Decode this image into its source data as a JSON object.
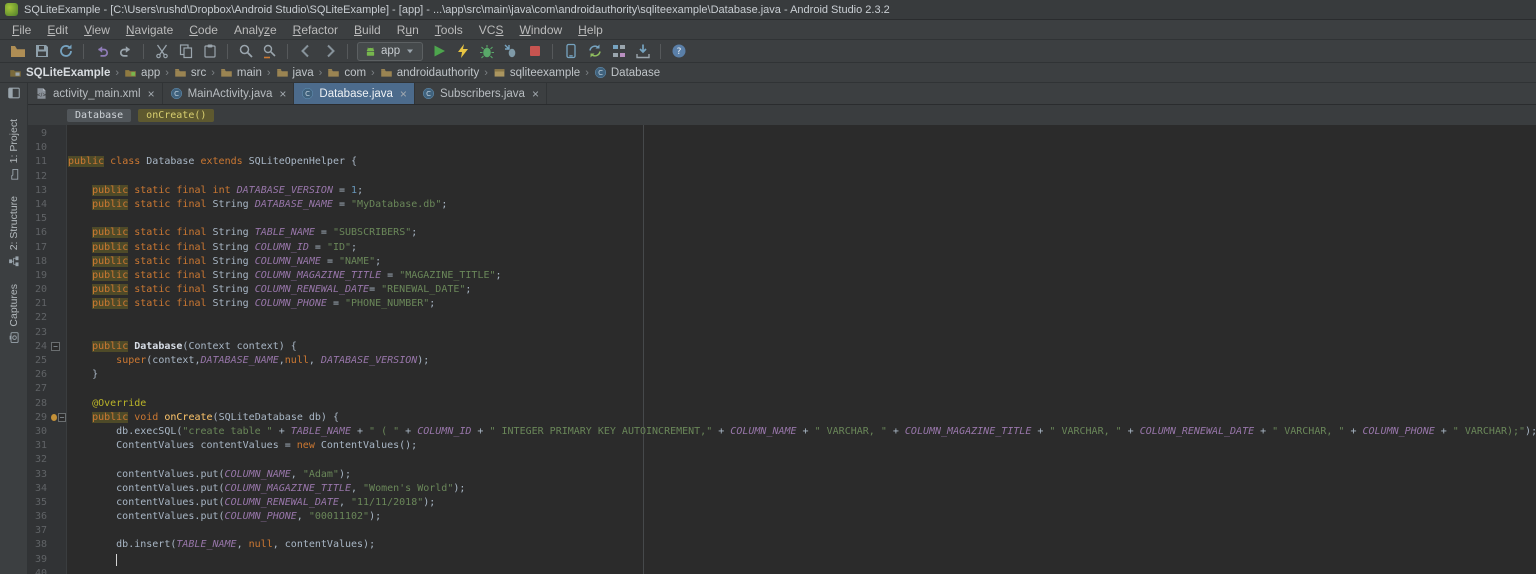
{
  "title_bar": {
    "title": "SQLiteExample - [C:\\Users\\rushd\\Dropbox\\Android Studio\\SQLiteExample] - [app] - ...\\app\\src\\main\\java\\com\\androidauthority\\sqliteexample\\Database.java - Android Studio 2.3.2"
  },
  "theme": {
    "editor_bg": "#2b2b2b",
    "gutter_bg": "#313335",
    "chrome_bg": "#3c3f41",
    "keyword": "#cc7832",
    "string": "#6a8759",
    "constant": "#9876aa",
    "number": "#6897bb",
    "annotation": "#bbb529",
    "method": "#ffc66b",
    "active_tab": "#4c6b8c",
    "occurrence_highlight": "#4e4a28",
    "run_green": "#4da54d",
    "stop_red": "#c75450"
  },
  "menu": {
    "items": [
      {
        "label": "File",
        "m": 0
      },
      {
        "label": "Edit",
        "m": 0
      },
      {
        "label": "View",
        "m": 0
      },
      {
        "label": "Navigate",
        "m": 0
      },
      {
        "label": "Code",
        "m": 0
      },
      {
        "label": "Analyze",
        "m": 5
      },
      {
        "label": "Refactor",
        "m": 0
      },
      {
        "label": "Build",
        "m": 0
      },
      {
        "label": "Run",
        "m": 1
      },
      {
        "label": "Tools",
        "m": 0
      },
      {
        "label": "VCS",
        "m": 2
      },
      {
        "label": "Window",
        "m": 0
      },
      {
        "label": "Help",
        "m": 0
      }
    ]
  },
  "toolbar": {
    "run_config_label": "app",
    "items": [
      {
        "icon": "open",
        "name": "open-file-button"
      },
      {
        "icon": "save",
        "name": "save-all-button"
      },
      {
        "icon": "sync",
        "name": "synchronize-button"
      },
      {
        "sep": true
      },
      {
        "icon": "undo",
        "name": "undo-button"
      },
      {
        "icon": "redo",
        "name": "redo-button"
      },
      {
        "sep": true
      },
      {
        "icon": "cut",
        "name": "cut-button"
      },
      {
        "icon": "copy",
        "name": "copy-button"
      },
      {
        "icon": "paste",
        "name": "paste-button"
      },
      {
        "sep": true
      },
      {
        "icon": "find",
        "name": "find-button"
      },
      {
        "icon": "replace",
        "name": "replace-button"
      },
      {
        "sep": true
      },
      {
        "icon": "back",
        "name": "back-button"
      },
      {
        "icon": "forward",
        "name": "forward-button"
      },
      {
        "sep": true
      },
      {
        "runconfig": true
      },
      {
        "icon": "run",
        "name": "run-button"
      },
      {
        "icon": "apply",
        "name": "instant-run-button"
      },
      {
        "icon": "debug",
        "name": "debug-button"
      },
      {
        "icon": "attach",
        "name": "attach-debugger-button"
      },
      {
        "icon": "stop",
        "name": "stop-button"
      },
      {
        "sep": true
      },
      {
        "icon": "avd",
        "name": "avd-manager-button"
      },
      {
        "icon": "gradle",
        "name": "gradle-sync-button"
      },
      {
        "icon": "structure",
        "name": "project-structure-button"
      },
      {
        "icon": "sdk",
        "name": "sdk-manager-button"
      },
      {
        "sep": true
      },
      {
        "icon": "help",
        "name": "help-button"
      }
    ]
  },
  "navbar": {
    "separator": "›",
    "items": [
      {
        "label": "SQLiteExample",
        "icon": "project",
        "bold": true
      },
      {
        "label": "app",
        "icon": "module"
      },
      {
        "label": "src",
        "icon": "folder"
      },
      {
        "label": "main",
        "icon": "folder"
      },
      {
        "label": "java",
        "icon": "folder"
      },
      {
        "label": "com",
        "icon": "folder"
      },
      {
        "label": "androidauthority",
        "icon": "folder"
      },
      {
        "label": "sqliteexample",
        "icon": "package"
      },
      {
        "label": "Database",
        "icon": "class"
      }
    ]
  },
  "tool_windows": {
    "toggle_icon": "panel",
    "left": [
      {
        "label": "1: Project",
        "icon": "projectstub"
      },
      {
        "label": "2: Structure",
        "icon": "structurestub"
      },
      {
        "label": "Captures",
        "icon": "capturesstub"
      }
    ]
  },
  "tabs": {
    "close_glyph": "×",
    "items": [
      {
        "label": "activity_main.xml",
        "icon": "xmlfile",
        "active": false
      },
      {
        "label": "MainActivity.java",
        "icon": "class",
        "active": false
      },
      {
        "label": "Database.java",
        "icon": "class",
        "active": true
      },
      {
        "label": "Subscribers.java",
        "icon": "class",
        "active": false
      }
    ]
  },
  "breadcrumbs": {
    "items": [
      {
        "label": "Database",
        "state": "plain"
      },
      {
        "label": "onCreate()",
        "state": "active"
      }
    ]
  },
  "editor": {
    "first_line": 9,
    "caret": {
      "line": 39,
      "col": 8
    },
    "lines": [
      {
        "n": 9,
        "t": []
      },
      {
        "n": 10,
        "t": []
      },
      {
        "n": 11,
        "t": [
          [
            "kh",
            "public"
          ],
          [
            "p",
            " "
          ],
          [
            "k",
            "class"
          ],
          [
            "p",
            " Database "
          ],
          [
            "k",
            "extends"
          ],
          [
            "p",
            " SQLiteOpenHelper {"
          ]
        ]
      },
      {
        "n": 12,
        "t": []
      },
      {
        "n": 13,
        "t": [
          [
            "p",
            "    "
          ],
          [
            "kh",
            "public"
          ],
          [
            "p",
            " "
          ],
          [
            "k",
            "static"
          ],
          [
            "p",
            " "
          ],
          [
            "k",
            "final"
          ],
          [
            "p",
            " "
          ],
          [
            "k",
            "int"
          ],
          [
            "p",
            " "
          ],
          [
            "c",
            "DATABASE_VERSION"
          ],
          [
            "p",
            " = "
          ],
          [
            "n",
            "1"
          ],
          [
            "p",
            ";"
          ]
        ]
      },
      {
        "n": 14,
        "t": [
          [
            "p",
            "    "
          ],
          [
            "kh",
            "public"
          ],
          [
            "p",
            " "
          ],
          [
            "k",
            "static"
          ],
          [
            "p",
            " "
          ],
          [
            "k",
            "final"
          ],
          [
            "p",
            " String "
          ],
          [
            "c",
            "DATABASE_NAME"
          ],
          [
            "p",
            " = "
          ],
          [
            "s",
            "\"MyDatabase.db\""
          ],
          [
            "p",
            ";"
          ]
        ]
      },
      {
        "n": 15,
        "t": []
      },
      {
        "n": 16,
        "t": [
          [
            "p",
            "    "
          ],
          [
            "kh",
            "public"
          ],
          [
            "p",
            " "
          ],
          [
            "k",
            "static"
          ],
          [
            "p",
            " "
          ],
          [
            "k",
            "final"
          ],
          [
            "p",
            " String "
          ],
          [
            "c",
            "TABLE_NAME"
          ],
          [
            "p",
            " = "
          ],
          [
            "s",
            "\"SUBSCRIBERS\""
          ],
          [
            "p",
            ";"
          ]
        ]
      },
      {
        "n": 17,
        "t": [
          [
            "p",
            "    "
          ],
          [
            "kh",
            "public"
          ],
          [
            "p",
            " "
          ],
          [
            "k",
            "static"
          ],
          [
            "p",
            " "
          ],
          [
            "k",
            "final"
          ],
          [
            "p",
            " String "
          ],
          [
            "c",
            "COLUMN_ID"
          ],
          [
            "p",
            " = "
          ],
          [
            "s",
            "\"ID\""
          ],
          [
            "p",
            ";"
          ]
        ]
      },
      {
        "n": 18,
        "t": [
          [
            "p",
            "    "
          ],
          [
            "kh",
            "public"
          ],
          [
            "p",
            " "
          ],
          [
            "k",
            "static"
          ],
          [
            "p",
            " "
          ],
          [
            "k",
            "final"
          ],
          [
            "p",
            " String "
          ],
          [
            "c",
            "COLUMN_NAME"
          ],
          [
            "p",
            " = "
          ],
          [
            "s",
            "\"NAME\""
          ],
          [
            "p",
            ";"
          ]
        ]
      },
      {
        "n": 19,
        "t": [
          [
            "p",
            "    "
          ],
          [
            "kh",
            "public"
          ],
          [
            "p",
            " "
          ],
          [
            "k",
            "static"
          ],
          [
            "p",
            " "
          ],
          [
            "k",
            "final"
          ],
          [
            "p",
            " String "
          ],
          [
            "c",
            "COLUMN_MAGAZINE_TITLE"
          ],
          [
            "p",
            " = "
          ],
          [
            "s",
            "\"MAGAZINE_TITLE\""
          ],
          [
            "p",
            ";"
          ]
        ]
      },
      {
        "n": 20,
        "t": [
          [
            "p",
            "    "
          ],
          [
            "kh",
            "public"
          ],
          [
            "p",
            " "
          ],
          [
            "k",
            "static"
          ],
          [
            "p",
            " "
          ],
          [
            "k",
            "final"
          ],
          [
            "p",
            " String "
          ],
          [
            "c",
            "COLUMN_RENEWAL_DATE"
          ],
          [
            "p",
            "= "
          ],
          [
            "s",
            "\"RENEWAL_DATE\""
          ],
          [
            "p",
            ";"
          ]
        ]
      },
      {
        "n": 21,
        "t": [
          [
            "p",
            "    "
          ],
          [
            "kh",
            "public"
          ],
          [
            "p",
            " "
          ],
          [
            "k",
            "static"
          ],
          [
            "p",
            " "
          ],
          [
            "k",
            "final"
          ],
          [
            "p",
            " String "
          ],
          [
            "c",
            "COLUMN_PHONE"
          ],
          [
            "p",
            " = "
          ],
          [
            "s",
            "\"PHONE_NUMBER\""
          ],
          [
            "p",
            ";"
          ]
        ]
      },
      {
        "n": 22,
        "t": []
      },
      {
        "n": 23,
        "t": []
      },
      {
        "n": 24,
        "fold": true,
        "t": [
          [
            "p",
            "    "
          ],
          [
            "kh",
            "public"
          ],
          [
            "p",
            " "
          ],
          [
            "w",
            "Database"
          ],
          [
            "p",
            "(Context context) {"
          ]
        ]
      },
      {
        "n": 25,
        "t": [
          [
            "p",
            "        "
          ],
          [
            "k",
            "super"
          ],
          [
            "p",
            "(context,"
          ],
          [
            "c",
            "DATABASE_NAME"
          ],
          [
            "p",
            ","
          ],
          [
            "k",
            "null"
          ],
          [
            "p",
            ", "
          ],
          [
            "c",
            "DATABASE_VERSION"
          ],
          [
            "p",
            ");"
          ]
        ]
      },
      {
        "n": 26,
        "t": [
          [
            "p",
            "    }"
          ]
        ]
      },
      {
        "n": 27,
        "t": []
      },
      {
        "n": 28,
        "t": [
          [
            "p",
            "    "
          ],
          [
            "a",
            "@Override"
          ]
        ]
      },
      {
        "n": 29,
        "fold": true,
        "gicon": "override",
        "t": [
          [
            "p",
            "    "
          ],
          [
            "kh",
            "public"
          ],
          [
            "p",
            " "
          ],
          [
            "k",
            "void"
          ],
          [
            "p",
            " "
          ],
          [
            "m",
            "onCreate"
          ],
          [
            "p",
            "(SQLiteDatabase db) {"
          ]
        ]
      },
      {
        "n": 30,
        "t": [
          [
            "p",
            "        db.execSQL("
          ],
          [
            "s",
            "\"create table \""
          ],
          [
            "p",
            " + "
          ],
          [
            "c",
            "TABLE_NAME"
          ],
          [
            "p",
            " + "
          ],
          [
            "s",
            "\" ( \""
          ],
          [
            "p",
            " + "
          ],
          [
            "c",
            "COLUMN_ID"
          ],
          [
            "p",
            " + "
          ],
          [
            "s",
            "\" INTEGER PRIMARY KEY AUTOINCREMENT,\""
          ],
          [
            "p",
            " + "
          ],
          [
            "c",
            "COLUMN_NAME"
          ],
          [
            "p",
            " + "
          ],
          [
            "s",
            "\" VARCHAR, \""
          ],
          [
            "p",
            " + "
          ],
          [
            "c",
            "COLUMN_MAGAZINE_TITLE"
          ],
          [
            "p",
            " + "
          ],
          [
            "s",
            "\" VARCHAR, \""
          ],
          [
            "p",
            " + "
          ],
          [
            "c",
            "COLUMN_RENEWAL_DATE"
          ],
          [
            "p",
            " + "
          ],
          [
            "s",
            "\" VARCHAR, \""
          ],
          [
            "p",
            " + "
          ],
          [
            "c",
            "COLUMN_PHONE"
          ],
          [
            "p",
            " + "
          ],
          [
            "s",
            "\" VARCHAR);\""
          ],
          [
            "p",
            ");"
          ]
        ]
      },
      {
        "n": 31,
        "t": [
          [
            "p",
            "        ContentValues contentValues = "
          ],
          [
            "k",
            "new"
          ],
          [
            "p",
            " ContentValues();"
          ]
        ]
      },
      {
        "n": 32,
        "t": []
      },
      {
        "n": 33,
        "t": [
          [
            "p",
            "        contentValues.put("
          ],
          [
            "c",
            "COLUMN_NAME"
          ],
          [
            "p",
            ", "
          ],
          [
            "s",
            "\"Adam\""
          ],
          [
            "p",
            ");"
          ]
        ]
      },
      {
        "n": 34,
        "t": [
          [
            "p",
            "        contentValues.put("
          ],
          [
            "c",
            "COLUMN_MAGAZINE_TITLE"
          ],
          [
            "p",
            ", "
          ],
          [
            "s",
            "\"Women's World\""
          ],
          [
            "p",
            ");"
          ]
        ]
      },
      {
        "n": 35,
        "t": [
          [
            "p",
            "        contentValues.put("
          ],
          [
            "c",
            "COLUMN_RENEWAL_DATE"
          ],
          [
            "p",
            ", "
          ],
          [
            "s",
            "\"11/11/2018\""
          ],
          [
            "p",
            ");"
          ]
        ]
      },
      {
        "n": 36,
        "t": [
          [
            "p",
            "        contentValues.put("
          ],
          [
            "c",
            "COLUMN_PHONE"
          ],
          [
            "p",
            ", "
          ],
          [
            "s",
            "\"00011102\""
          ],
          [
            "p",
            ");"
          ]
        ]
      },
      {
        "n": 37,
        "t": []
      },
      {
        "n": 38,
        "t": [
          [
            "p",
            "        db.insert("
          ],
          [
            "c",
            "TABLE_NAME"
          ],
          [
            "p",
            ", "
          ],
          [
            "k",
            "null"
          ],
          [
            "p",
            ", contentValues);"
          ]
        ]
      },
      {
        "n": 39,
        "t": []
      },
      {
        "n": 40,
        "t": []
      }
    ]
  }
}
